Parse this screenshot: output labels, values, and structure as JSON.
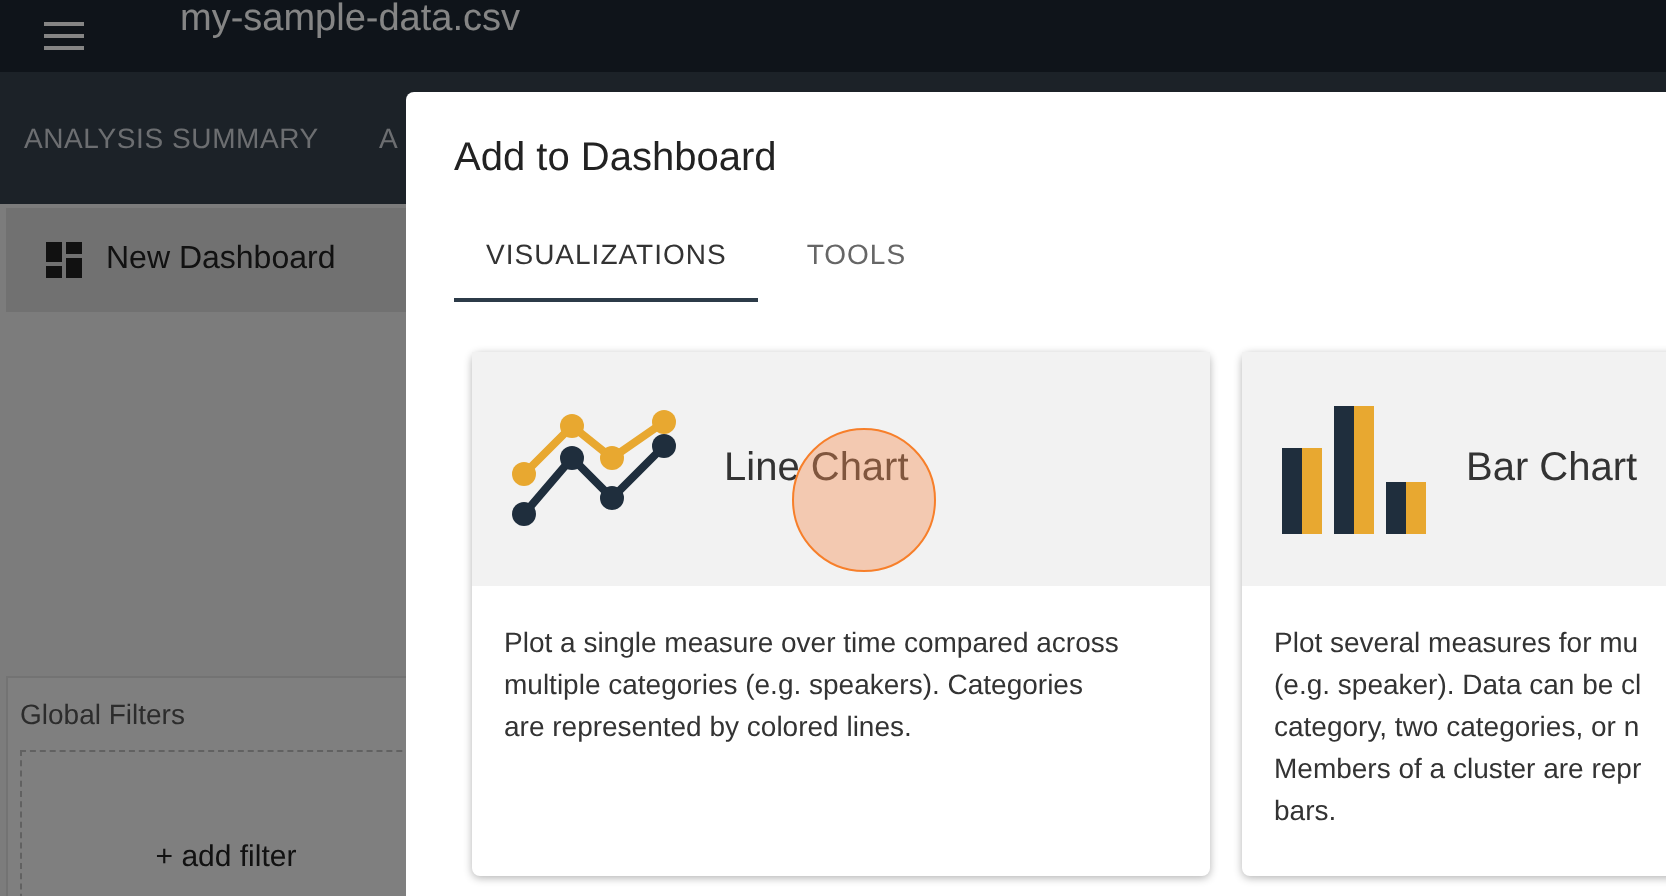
{
  "app_bar": {
    "title": "my-sample-data.csv"
  },
  "nav_tabs": [
    {
      "label": "ANALYSIS SUMMARY"
    },
    {
      "label": "A"
    }
  ],
  "sidebar": {
    "item": "New Dashboard",
    "filters_title": "Global Filters",
    "add_filter": "+ add filter"
  },
  "dialog": {
    "title": "Add to Dashboard",
    "tabs": [
      {
        "label": "VISUALIZATIONS",
        "selected": true
      },
      {
        "label": "TOOLS",
        "selected": false
      }
    ],
    "cards": [
      {
        "kind": "line",
        "title": "Line Chart",
        "lines": [
          "Plot a single measure over time compared across",
          "multiple categories (e.g. speakers). Categories",
          "are represented by colored lines."
        ]
      },
      {
        "kind": "bar",
        "title": "Bar Chart",
        "lines": [
          "Plot several measures for mu",
          "(e.g. speaker). Data can be cl",
          "category, two categories, or n",
          "Members of a cluster are repr",
          "bars."
        ]
      }
    ]
  }
}
